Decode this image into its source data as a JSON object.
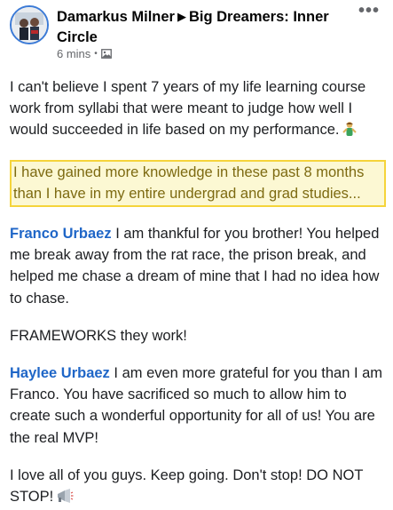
{
  "post": {
    "author": "Damarkus Milner",
    "separator": "▶",
    "group": "Big Dreamers: Inner Circle",
    "timestamp": "6 mins",
    "meta_dot": "•",
    "audience_icon": "photo-icon",
    "more_label": "•••"
  },
  "content": {
    "para1": "I can't believe I spent 7 years of my life learning course work from syllabi that were meant to judge how well I would succeeded in life based on my performance.",
    "para1_emoji": "person-gesturing-emoji",
    "highlight": "I have gained more knowledge in these past 8 months than I have in my entire undergrad and grad studies...",
    "mention1": "Franco Urbaez",
    "para2": " I am thankful for you brother! You helped me break away from the rat race, the prison break, and helped me chase a dream of mine that I had no idea how to chase.",
    "para3": "FRAMEWORKS they work!",
    "mention2": "Haylee Urbaez",
    "para4": " I am even more grateful for you than I am Franco. You have sacrificed so much to allow him to create such a wonderful opportunity for all of us! You are the real MVP!",
    "para5": "I love all of you guys. Keep going. Don't stop! DO NOT STOP!",
    "para5_emoji": "megaphone-emoji"
  },
  "colors": {
    "mention": "#1f66c7",
    "highlight_bg": "#fcf8d3",
    "highlight_border": "#f5d43a",
    "avatar_ring": "#3b7ad6"
  }
}
